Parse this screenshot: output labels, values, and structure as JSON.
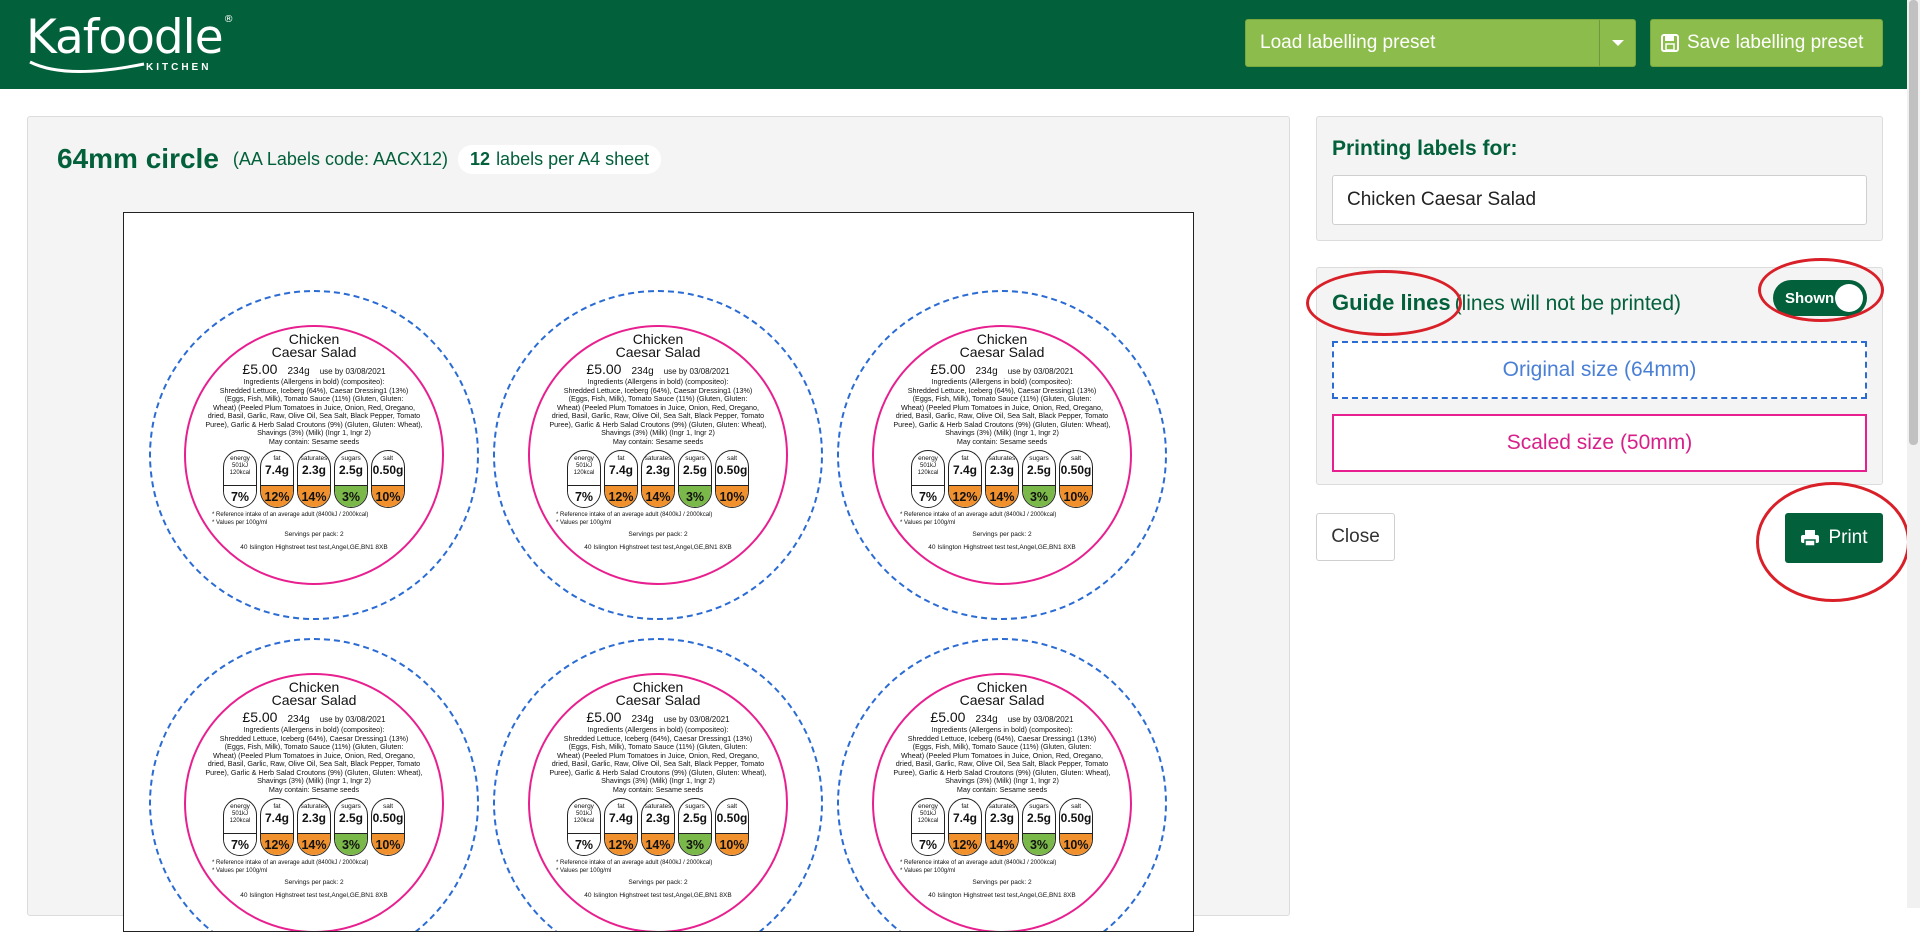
{
  "header": {
    "logo_main": "Kafoodle",
    "logo_registered": "®",
    "logo_sub": "KITCHEN",
    "load_preset_label": "Load labelling preset",
    "save_preset_label": "Save labelling preset",
    "background_color": "#02603b",
    "button_color": "#8cbd4c"
  },
  "sheet": {
    "name": "64mm circle",
    "code": "(AA Labels code: AACX12)",
    "count": "12",
    "count_suffix": "labels per A4 sheet"
  },
  "label": {
    "title_line1": "Chicken",
    "title_line2": "Caesar Salad",
    "price": "£5.00",
    "weight": "234g",
    "use_by": "use by 03/08/2021",
    "ingredients_header": "Ingredients (Allergens in bold) (compositeo):",
    "ingredients_l1": "Shredded Lettuce, Iceberg (64%), Caesar Dressing1 (13%)",
    "ingredients_l2": "(Eggs, Fish, Milk), Tomato Sauce (11%) (Gluten, Gluten:",
    "ingredients_l3": "Wheat) (Peeled Plum Tomatoes in Juice, Onion, Red, Oregano,",
    "ingredients_l4": "dried, Basil, Garlic, Raw, Olive Oil, Sea Salt, Black Pepper, Tomato",
    "ingredients_l5": "Puree), Garlic & Herb Salad Croutons (9%) (Gluten, Gluten: Wheat),",
    "ingredients_l6": "Shavings (3%) (Milk) (Ingr 1, Ingr 2)",
    "may_contain": "May contain: Sesame seeds",
    "traffic_lights": [
      {
        "name": "energy",
        "value": "501kJ 120kcal",
        "percent": "7%",
        "color": "#ffffff"
      },
      {
        "name": "fat",
        "value": "7.4g",
        "percent": "12%",
        "color": "#f0912d"
      },
      {
        "name": "saturates",
        "value": "2.3g",
        "percent": "14%",
        "color": "#f0912d"
      },
      {
        "name": "sugars",
        "value": "2.5g",
        "percent": "3%",
        "color": "#7bb84a"
      },
      {
        "name": "salt",
        "value": "0.50g",
        "percent": "10%",
        "color": "#f0912d"
      }
    ],
    "reference_intake": "* Reference intake of an average adult (8400kJ / 2000kcal)",
    "values_per": "* Values per 100g/ml",
    "servings": "Servings per pack: 2",
    "address": "40 Islington Highstreet test test,Angel,GE,BN1 8XB"
  },
  "printing": {
    "label": "Printing labels for:",
    "value": "Chicken Caesar Salad"
  },
  "guides": {
    "title": "Guide lines",
    "subtitle": "(lines will not be printed)",
    "toggle_label": "Shown",
    "original_size": "Original size (64mm)",
    "scaled_size": "Scaled size (50mm)",
    "original_color": "#2a6bd4",
    "scaled_color": "#e8208f"
  },
  "actions": {
    "close_label": "Close",
    "print_label": "Print"
  },
  "icons": {
    "dropdown": "chevron-down-icon",
    "save": "floppy-disk-icon",
    "print": "printer-icon"
  },
  "annotation_color": "#d92028"
}
